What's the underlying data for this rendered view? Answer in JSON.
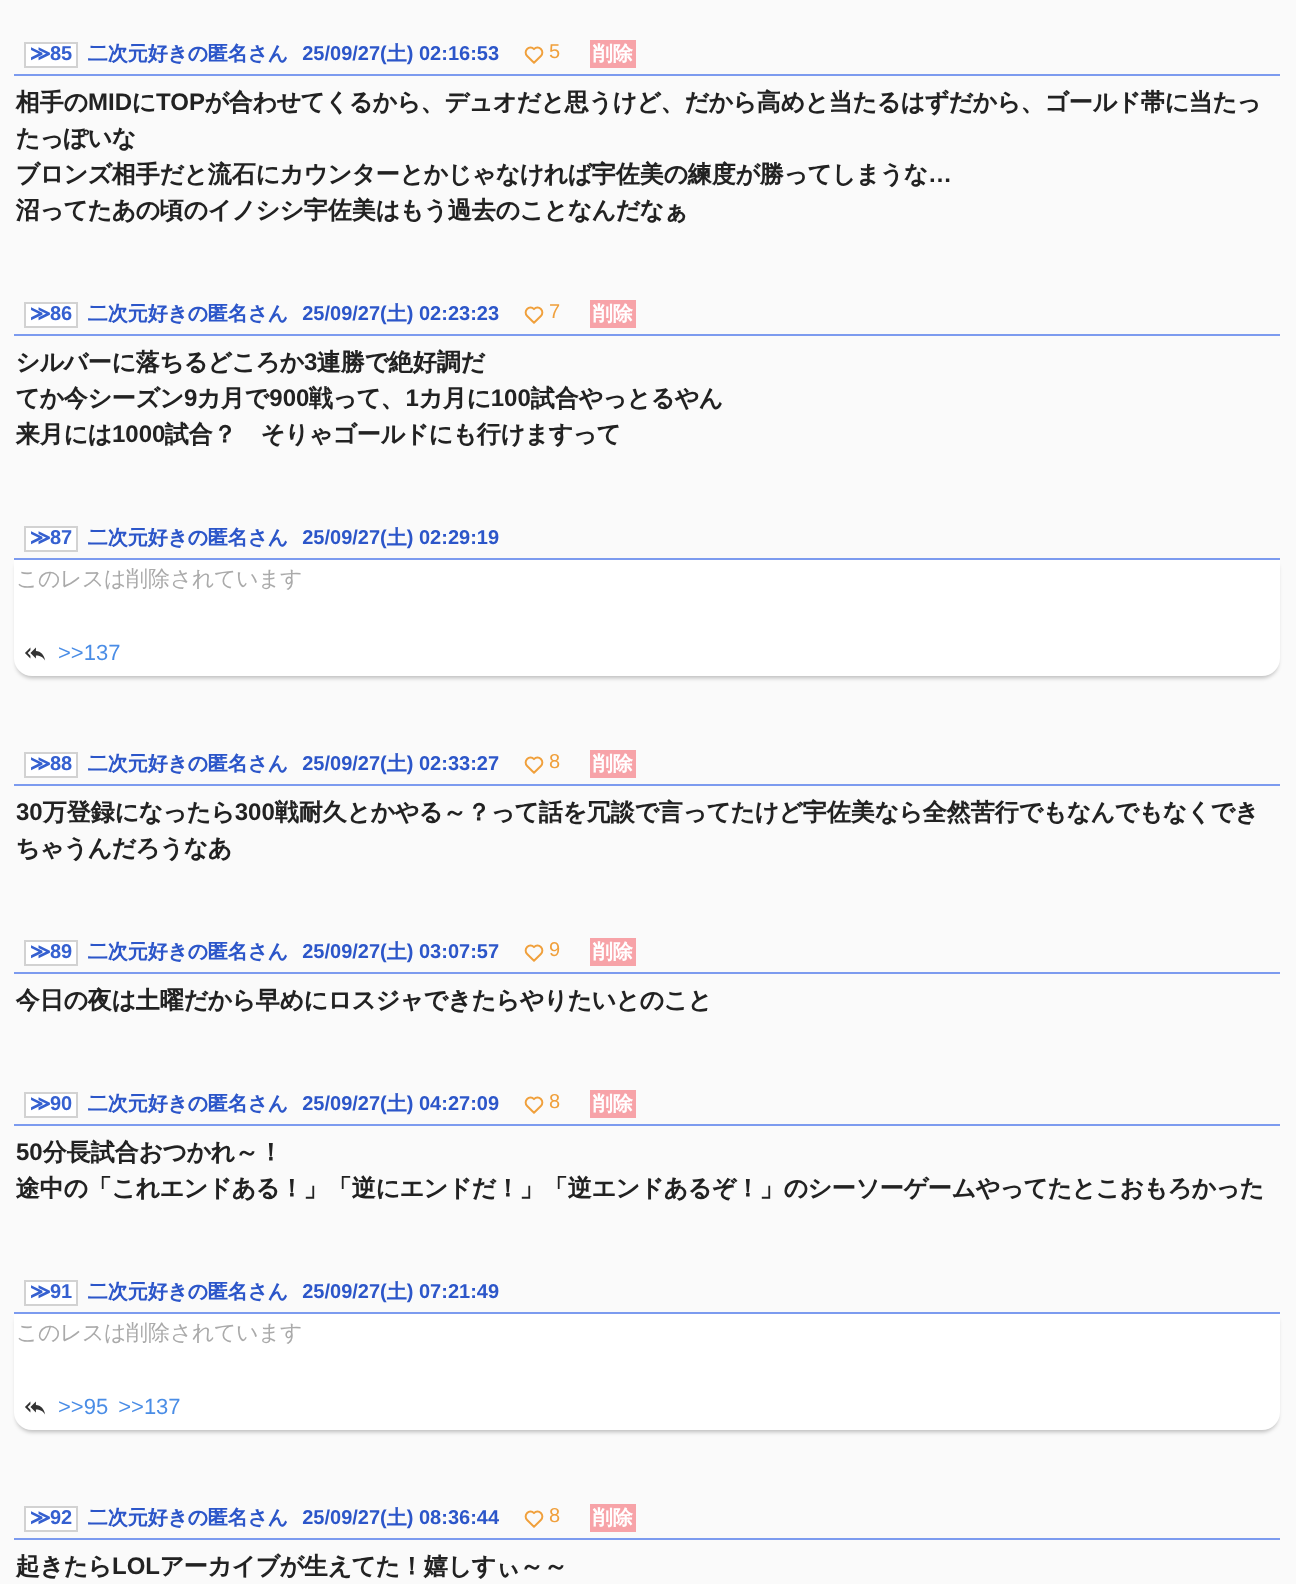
{
  "posts": [
    {
      "kind": "normal",
      "number": "≫85",
      "name": "二次元好きの匿名さん",
      "date": "25/09/27(土) 02:16:53",
      "likes": "5",
      "delete_label": "削除",
      "body": [
        "相手のMIDにTOPが合わせてくるから、デュオだと思うけど、だから高めと当たるはずだから、ゴールド帯に当たったっぽいな",
        "ブロンズ相手だと流石にカウンターとかじゃなければ宇佐美の練度が勝ってしまうな…",
        "沼ってたあの頃のイノシシ宇佐美はもう過去のことなんだなぁ"
      ]
    },
    {
      "kind": "normal",
      "number": "≫86",
      "name": "二次元好きの匿名さん",
      "date": "25/09/27(土) 02:23:23",
      "likes": "7",
      "delete_label": "削除",
      "body": [
        "シルバーに落ちるどころか3連勝で絶好調だ",
        "てか今シーズン9カ月で900戦って、1カ月に100試合やっとるやん",
        "来月には1000試合？　そりゃゴールドにも行けますって"
      ]
    },
    {
      "kind": "deleted",
      "number": "≫87",
      "name": "二次元好きの匿名さん",
      "date": "25/09/27(土) 02:29:19",
      "body": [
        "このレスは削除されています"
      ],
      "replies": [
        ">>137"
      ]
    },
    {
      "kind": "normal",
      "number": "≫88",
      "name": "二次元好きの匿名さん",
      "date": "25/09/27(土) 02:33:27",
      "likes": "8",
      "delete_label": "削除",
      "body": [
        "30万登録になったら300戦耐久とかやる～？って話を冗談で言ってたけど宇佐美なら全然苦行でもなんでもなくできちゃうんだろうなあ"
      ]
    },
    {
      "kind": "normal",
      "number": "≫89",
      "name": "二次元好きの匿名さん",
      "date": "25/09/27(土) 03:07:57",
      "likes": "9",
      "delete_label": "削除",
      "body": [
        "今日の夜は土曜だから早めにロスジャできたらやりたいとのこと"
      ]
    },
    {
      "kind": "normal",
      "number": "≫90",
      "name": "二次元好きの匿名さん",
      "date": "25/09/27(土) 04:27:09",
      "likes": "8",
      "delete_label": "削除",
      "body": [
        "50分長試合おつかれ～！",
        "途中の「これエンドある！」「逆にエンドだ！」「逆エンドあるぞ！」のシーソーゲームやってたとこおもろかった"
      ]
    },
    {
      "kind": "deleted",
      "number": "≫91",
      "name": "二次元好きの匿名さん",
      "date": "25/09/27(土) 07:21:49",
      "body": [
        "このレスは削除されています"
      ],
      "replies": [
        ">>95",
        ">>137"
      ]
    },
    {
      "kind": "normal",
      "number": "≫92",
      "name": "二次元好きの匿名さん",
      "date": "25/09/27(土) 08:36:44",
      "likes": "8",
      "delete_label": "削除",
      "body": [
        "起きたらLOLアーカイブが生えてた！嬉しすぃ～～"
      ]
    }
  ]
}
